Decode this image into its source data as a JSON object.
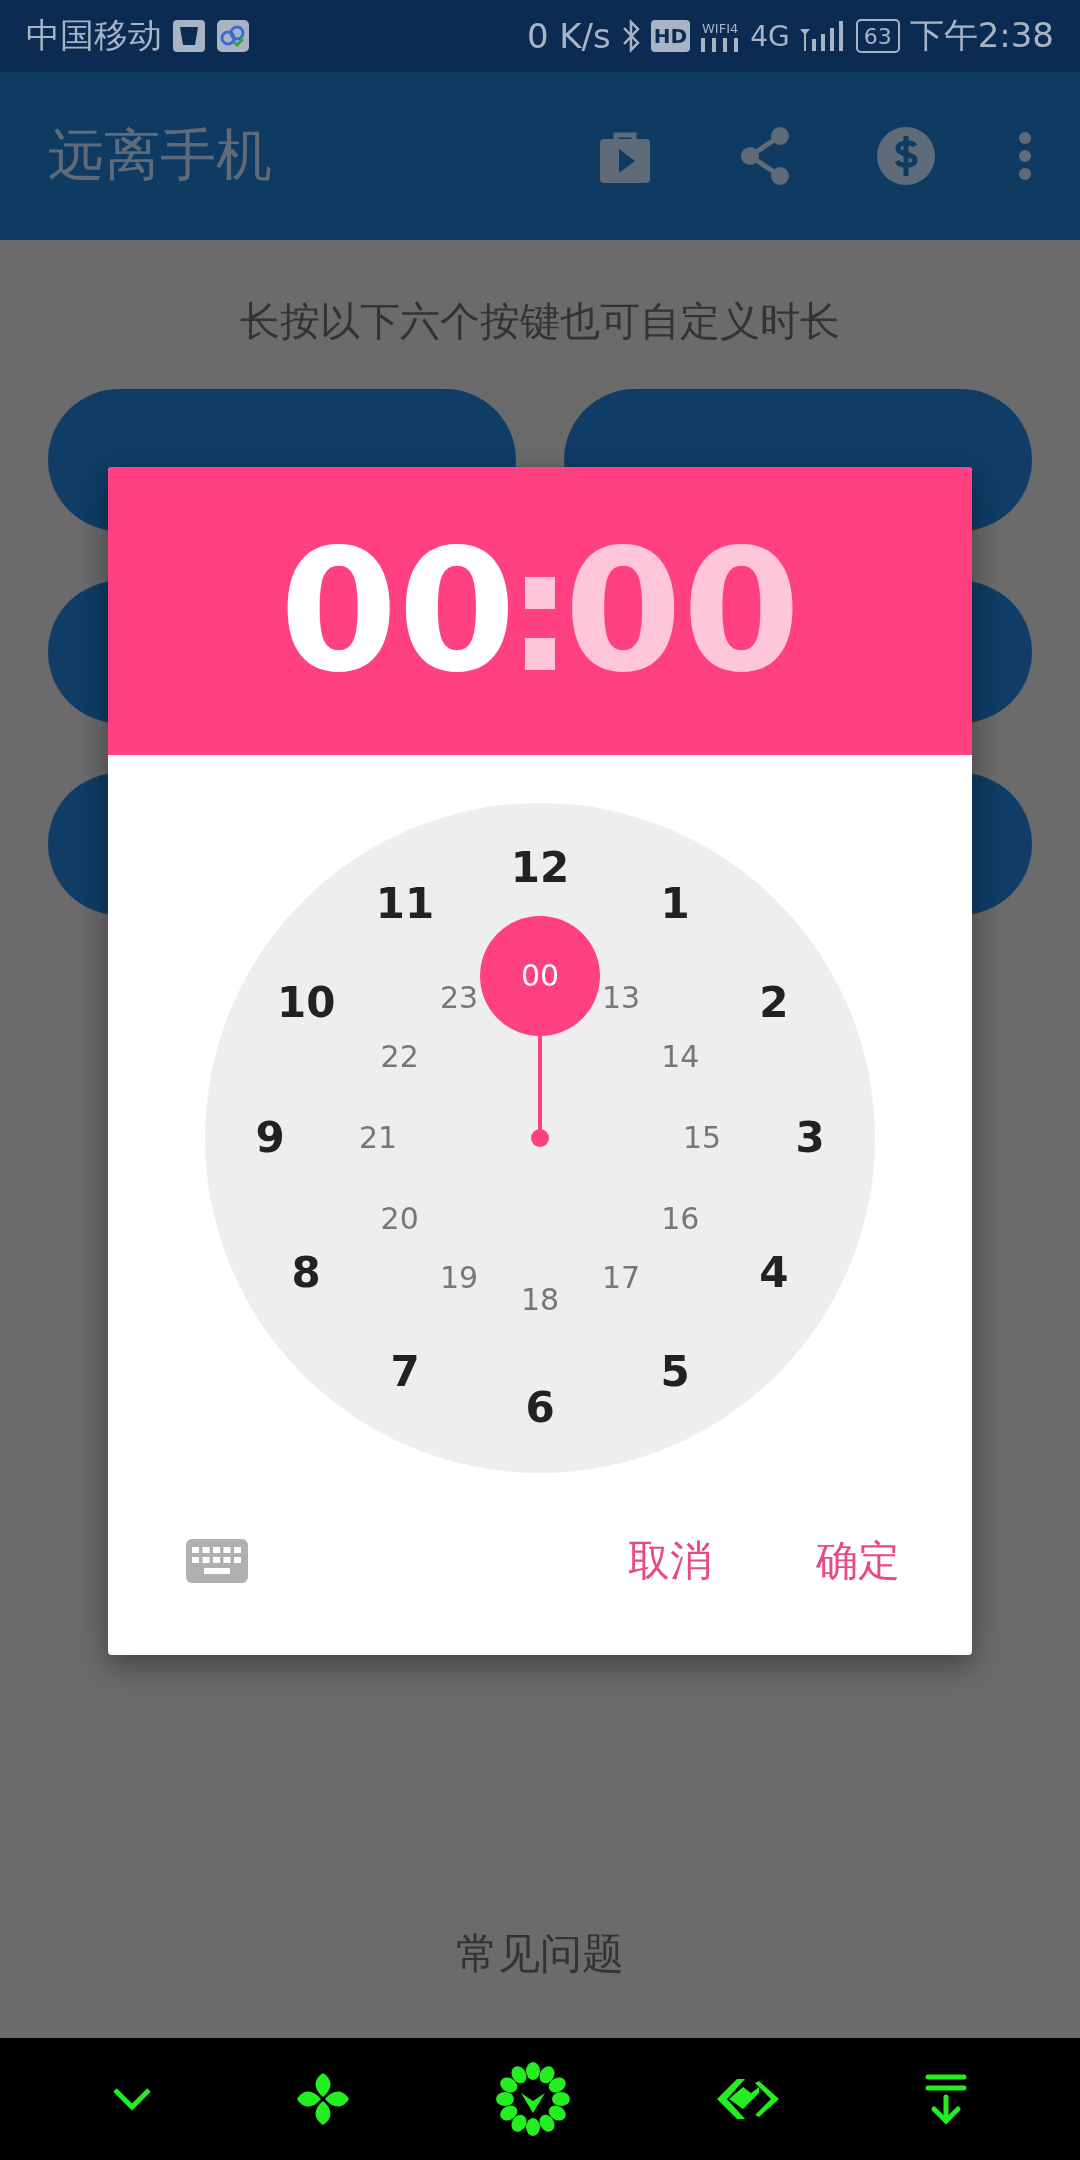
{
  "status_bar": {
    "carrier": "中国移动",
    "speed": "0 K/s",
    "hd": "HD",
    "wifi": "WIFI4",
    "network": "4G",
    "battery": "63",
    "time": "下午2:38"
  },
  "app_bar": {
    "title": "远离手机"
  },
  "hint": "长按以下六个按键也可自定义时长",
  "faq": "常见问题",
  "dialog": {
    "hours": {
      "text": "00",
      "selected": true
    },
    "separator": ":",
    "minutes": {
      "text": "00",
      "selected": false
    },
    "outer_numbers": [
      {
        "text": "12",
        "selected": false
      },
      {
        "text": "1",
        "selected": false
      },
      {
        "text": "2",
        "selected": false
      },
      {
        "text": "3",
        "selected": false
      },
      {
        "text": "4",
        "selected": false
      },
      {
        "text": "5",
        "selected": false
      },
      {
        "text": "6",
        "selected": false
      },
      {
        "text": "7",
        "selected": false
      },
      {
        "text": "8",
        "selected": false
      },
      {
        "text": "9",
        "selected": false
      },
      {
        "text": "10",
        "selected": false
      },
      {
        "text": "11",
        "selected": false
      }
    ],
    "inner_numbers": [
      {
        "text": "00",
        "selected": true
      },
      {
        "text": "13",
        "selected": false
      },
      {
        "text": "14",
        "selected": false
      },
      {
        "text": "15",
        "selected": false
      },
      {
        "text": "16",
        "selected": false
      },
      {
        "text": "17",
        "selected": false
      },
      {
        "text": "18",
        "selected": false
      },
      {
        "text": "19",
        "selected": false
      },
      {
        "text": "20",
        "selected": false
      },
      {
        "text": "21",
        "selected": false
      },
      {
        "text": "22",
        "selected": false
      },
      {
        "text": "23",
        "selected": false
      }
    ],
    "cancel": "取消",
    "confirm": "确定"
  }
}
